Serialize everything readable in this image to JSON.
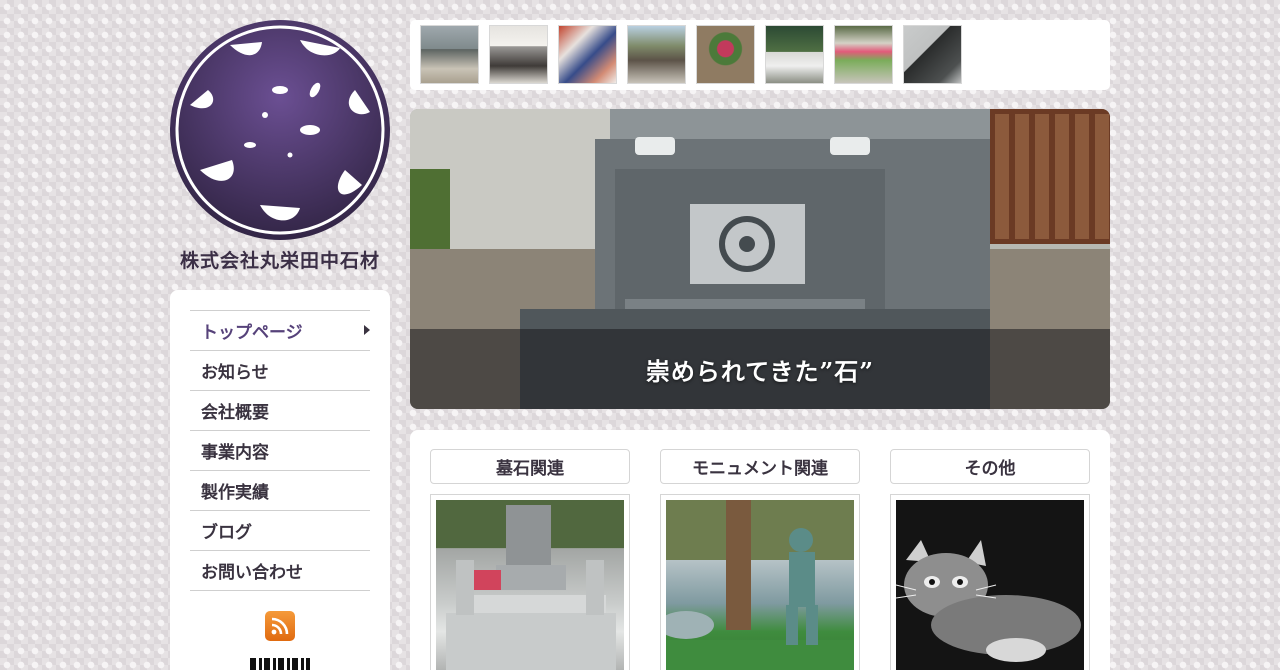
{
  "brand": {
    "company_name": "株式会社丸栄田中石材",
    "logo_icon": "flower-crest-emblem",
    "primary_color": "#4a3766"
  },
  "sidebar": {
    "nav_items": [
      {
        "label": "トップページ",
        "active": true
      },
      {
        "label": "お知らせ",
        "active": false
      },
      {
        "label": "会社概要",
        "active": false
      },
      {
        "label": "事業内容",
        "active": false
      },
      {
        "label": "製作実績",
        "active": false
      },
      {
        "label": "ブログ",
        "active": false
      },
      {
        "label": "お問い合わせ",
        "active": false
      }
    ],
    "rss_icon": "rss-feed-icon",
    "rss_color": "#f0831e"
  },
  "thumbnails": [
    {
      "icon": "grave-thumbnail"
    },
    {
      "icon": "building-thumbnail"
    },
    {
      "icon": "festival-thumbnail"
    },
    {
      "icon": "shrine-thumbnail"
    },
    {
      "icon": "flower-pot-thumbnail"
    },
    {
      "icon": "stone-bench-thumbnail"
    },
    {
      "icon": "flower-bed-thumbnail"
    },
    {
      "icon": "black-stone-thumbnail"
    }
  ],
  "hero": {
    "caption": "崇められてきた”石”"
  },
  "categories": [
    {
      "title": "墓石関連",
      "image": "grave-photo"
    },
    {
      "title": "モニュメント関連",
      "image": "monument-statue-photo"
    },
    {
      "title": "その他",
      "image": "engraved-cat-photo"
    }
  ]
}
